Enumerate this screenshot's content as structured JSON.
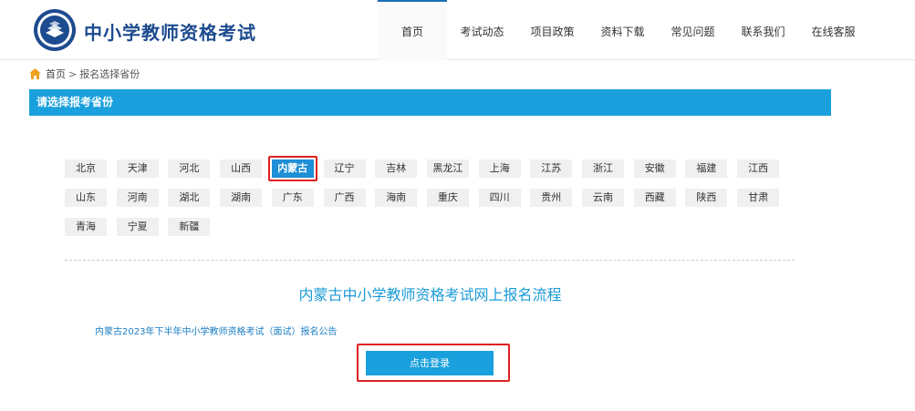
{
  "header": {
    "site_title": "中小学教师资格考试",
    "nav": [
      "首页",
      "考试动态",
      "项目政策",
      "资料下载",
      "常见问题",
      "联系我们",
      "在线客服"
    ]
  },
  "breadcrumb": {
    "home": "首页",
    "separator": ">",
    "current": "报名选择省份"
  },
  "section_title": "请选择报考省份",
  "provinces": [
    "北京",
    "天津",
    "河北",
    "山西",
    "内蒙古",
    "辽宁",
    "吉林",
    "黑龙江",
    "上海",
    "江苏",
    "浙江",
    "安徽",
    "福建",
    "江西",
    "山东",
    "河南",
    "湖北",
    "湖南",
    "广东",
    "广西",
    "海南",
    "重庆",
    "四川",
    "贵州",
    "云南",
    "西藏",
    "陕西",
    "甘肃",
    "青海",
    "宁夏",
    "新疆"
  ],
  "selected_province": "内蒙古",
  "flow_title": "内蒙古中小学教师资格考试网上报名流程",
  "notice_link": "内蒙古2023年下半年中小学教师资格考试（面试）报名公告",
  "login_button": "点击登录",
  "colors": {
    "brand_blue": "#1aa0dc",
    "title_navy": "#1d4b8f",
    "highlight_red": "#e02020"
  }
}
